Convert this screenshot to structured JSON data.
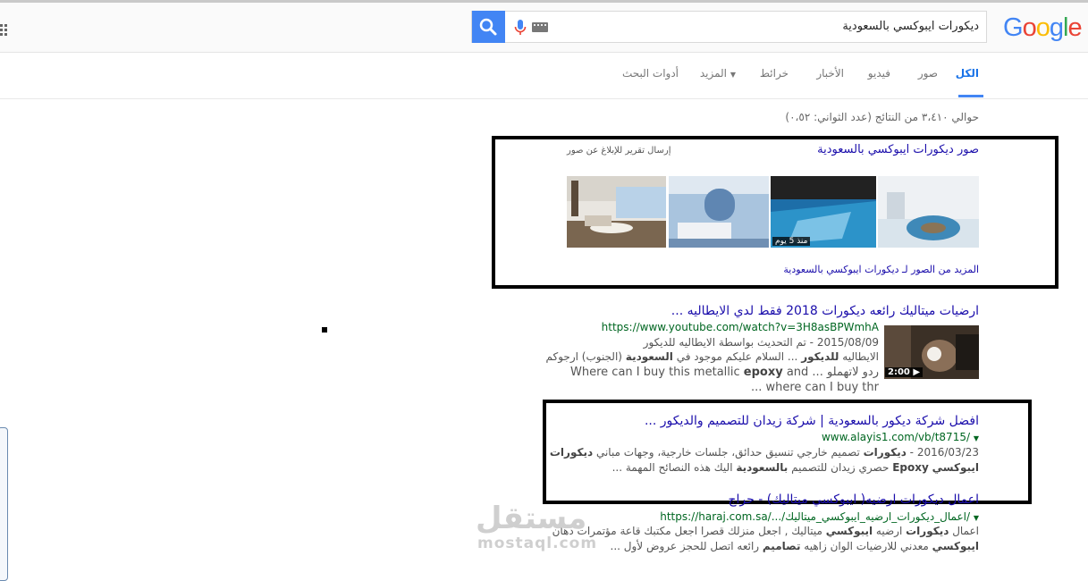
{
  "header": {
    "logo": {
      "G": "G",
      "o1": "o",
      "o2": "o",
      "g": "g",
      "l": "l",
      "e": "e"
    },
    "query": "ديكورات ايبوكسي بالسعودية"
  },
  "tabs": [
    {
      "label": "الكل"
    },
    {
      "label": "صور"
    },
    {
      "label": "فيديو"
    },
    {
      "label": "الأخبار"
    },
    {
      "label": "خرائط"
    },
    {
      "label": "المزيد"
    },
    {
      "label": "أدوات البحث"
    }
  ],
  "stats": "حوالي ٣،٤١٠ من النتائج (عدد الثواني: ٠،٥٢)",
  "images": {
    "heading": "صور ديكورات ايبوكسي بالسعودية",
    "report": "إرسال تقرير للإبلاغ عن صور",
    "badge": "منذ 5 يوم",
    "more": "المزيد من الصور لـ ديكورات ايبوكسي بالسعودية"
  },
  "results": [
    {
      "title": "ارضيات ميتاليك رائعه ديكورات 2018 فقط لدي الايطاليه ...",
      "url": "https://www.youtube.com/watch?v=3H8asBPWmhA",
      "meta": "2015/08/09 - تم التحديث بواسطة الايطاليه للديكور",
      "s1_pre": "الايطاليه ",
      "s1_b1": "للديكور",
      "s1_mid": " ... السلام عليكم موجود في ",
      "s1_b2": "السعودية",
      "s1_post": " (الجنوب) ارجوكم",
      "s2_pre": "ردو لاتهملو ... Where can I buy this metallic ",
      "s2_b": "epoxy",
      "s2_post": " and",
      "s3": "where can I buy thr ...",
      "duration": "2:00 ▶"
    },
    {
      "title": "افضل شركة ديكور بالسعودية | شركة زيدان للتصميم والديكور ...",
      "url": "www.alayis1.com/vb/t8715/",
      "date": "2016/03/23 - ",
      "s1_b": "ديكورات",
      "s1_post": " تصميم خارجي تنسيق حدائق، جلسات خارجية، وجهات مباني ",
      "s1_b2": "ديكورات",
      "s2_b1": "ايبوكسي",
      "s2_b2": "Epoxy",
      "s2_mid": " حصري زيدان للتصميم ",
      "s2_b3": "بالسعودية",
      "s2_post": " اليك هذه النصائح المهمة ..."
    },
    {
      "title": "اعمال ديكورات ارضيه( ايبوكسي ميتاليك) - حراج",
      "url": "https://haraj.com.sa/.../اعمال_ديكورات_ارضيه_ايبوكسي_ميتاليك/",
      "s1_pre": "اعمال ",
      "s1_b1": "ديكورات",
      "s1_mid": " ارضيه ",
      "s1_b2": "ايبوكسي",
      "s1_post": " ميتاليك , اجعل منزلك قصرا اجعل مكتبك قاعة مؤتمرات دهان",
      "s2_b1": "ايبوكسي",
      "s2_mid": " معدني للارضيات الوان زاهيه ",
      "s2_b2": "تصاميم",
      "s2_post": " رائعه اتصل للحجز عروض لأول ..."
    }
  ],
  "watermark": {
    "ar": "مستقل",
    "en": "mostaql.com"
  },
  "colors": {
    "link": "#1a0dab",
    "url": "#006621",
    "snippet": "#545454",
    "accent": "#4285f4"
  }
}
